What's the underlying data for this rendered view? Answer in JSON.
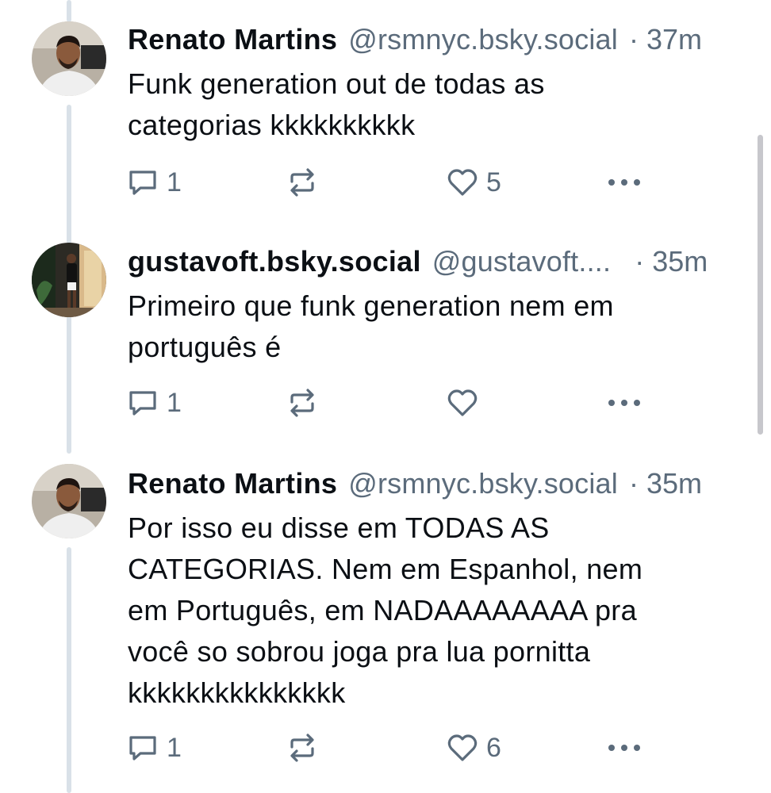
{
  "posts": [
    {
      "author_name": "Renato Martins",
      "author_handle": "@rsmnyc.bsky.social",
      "separator": "·",
      "time": "37m",
      "text": "Funk generation out de todas as\ncategorias kkkkkkkkkk",
      "replies": "1",
      "likes": "5"
    },
    {
      "author_name": "gustavoft.bsky.social",
      "author_handle": "@gustavoft....",
      "separator": "·",
      "time": "35m",
      "text": "Primeiro que funk generation nem em\nportuguês é",
      "replies": "1",
      "likes": ""
    },
    {
      "author_name": "Renato Martins",
      "author_handle": "@rsmnyc.bsky.social",
      "separator": "·",
      "time": "35m",
      "text": "Por isso eu disse em TODAS AS\nCATEGORIAS. Nem em Espanhol, nem\nem Português, em NADAAAAAAAA pra\nvocê so sobrou joga pra lua pornitta\nkkkkkkkkkkkkkkk",
      "replies": "1",
      "likes": "6"
    }
  ],
  "icons": {
    "reply": "reply-icon",
    "repost": "repost-icon",
    "like": "heart-icon",
    "more": "more-icon"
  },
  "colors": {
    "text": "#0b0f14",
    "muted": "#5b6b7b",
    "thread_line": "#d9e1e8"
  }
}
